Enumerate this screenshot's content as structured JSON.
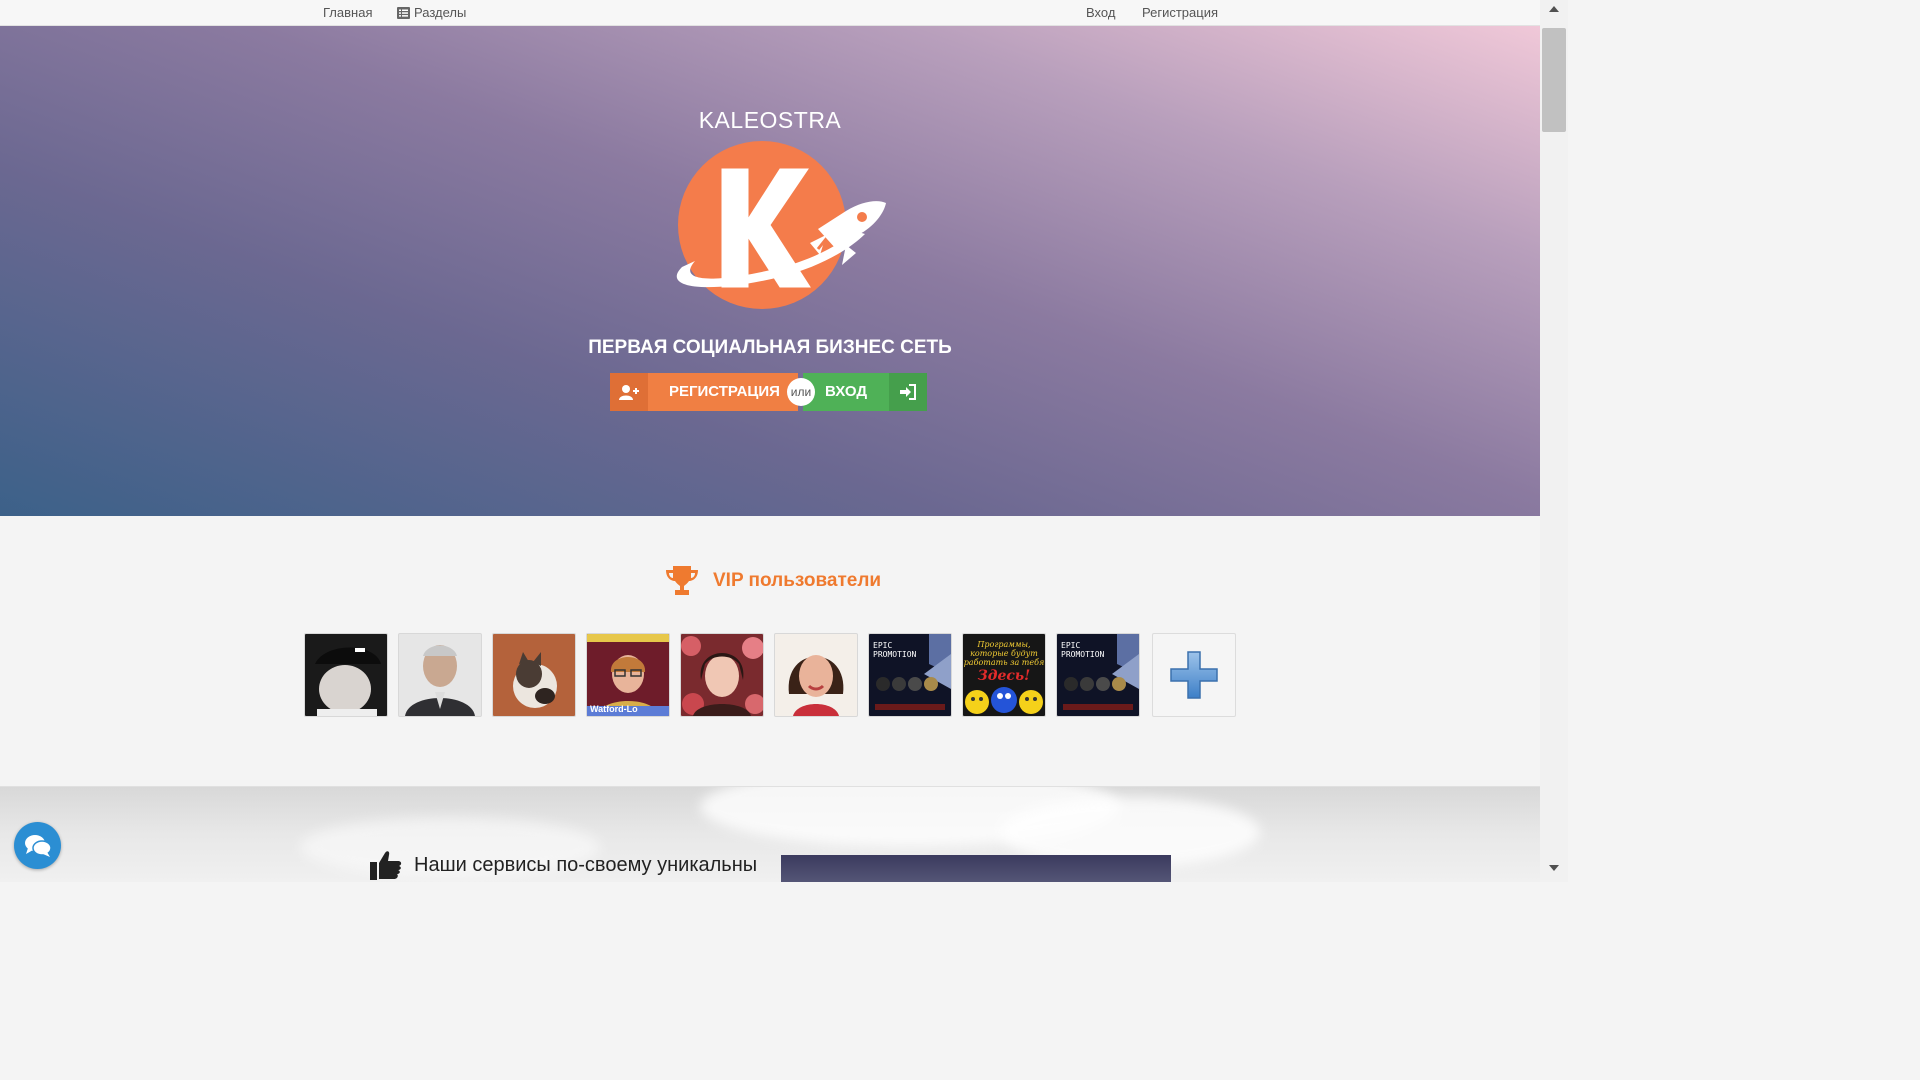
{
  "nav": {
    "home": "Главная",
    "sections": "Разделы",
    "login": "Вход",
    "register": "Регистрация"
  },
  "hero": {
    "brand": "KALEOSTRA",
    "tagline": "ПЕРВАЯ СОЦИАЛЬНАЯ БИЗНЕС СЕТЬ",
    "register_label": "РЕГИСТРАЦИЯ",
    "or_label": "или",
    "login_label": "ВХОД",
    "colors": {
      "register": "#f07f43",
      "login": "#4fb157",
      "logo": "#f47c4b"
    }
  },
  "vip": {
    "title": "VIP пользователи",
    "accent": "#ef7a2f",
    "avatars": [
      {
        "kind": "user-photo"
      },
      {
        "kind": "user-photo"
      },
      {
        "kind": "cat-photo"
      },
      {
        "kind": "user-photo"
      },
      {
        "kind": "user-photo"
      },
      {
        "kind": "user-photo"
      },
      {
        "kind": "promo-banner"
      },
      {
        "kind": "promo-banner"
      },
      {
        "kind": "promo-banner"
      },
      {
        "kind": "add-button"
      }
    ],
    "promo_epic": {
      "line1": "EPIC",
      "line2": "PROMOTION"
    },
    "promo_programs": {
      "line1": "Программы,",
      "line2": "которые будут",
      "line3": "работать за тебя",
      "line4": "Здесь!"
    },
    "avatar4_caption": "Watford-Lo"
  },
  "services": {
    "heading": "Наши сервисы по-своему уникальны"
  }
}
